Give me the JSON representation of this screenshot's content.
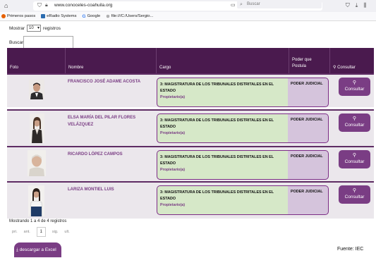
{
  "browser": {
    "url": "www.conoceles-coahuila.org",
    "search_placeholder": "Buscar",
    "bookmarks": [
      {
        "label": "Primeros pasos",
        "icon": "firefox-icon",
        "color": "#e66000"
      },
      {
        "label": "eRadio Systems",
        "icon": "eradio-icon",
        "color": "#2b6cb0"
      },
      {
        "label": "Google",
        "icon": "google-icon",
        "color": "#4285f4"
      },
      {
        "label": "file:///C:/Users/Sergio...",
        "icon": "globe-icon",
        "color": "#666666"
      }
    ]
  },
  "controls": {
    "show_prefix": "Mostrar",
    "show_value": "10",
    "show_suffix": "registros",
    "search_label": "Buscar:"
  },
  "table": {
    "headers": {
      "foto": "Foto",
      "nombre": "Nombre",
      "cargo": "Cargo",
      "poder_line1": "Poder que",
      "poder_line2": "Postula",
      "consultar": "Consultar"
    },
    "rows": [
      {
        "name_line1": "FRANCISCO JOSÉ ADAME ACOSTA",
        "name_line2": "",
        "cargo_line1": "3: MAGISTRATURA DE LOS TRIBUNALES DISTRITALES EN EL",
        "cargo_line2": "ESTADO",
        "tipo": "Propietario(a)",
        "poder": "PODER JUDICIAL",
        "button_label": "Consultar"
      },
      {
        "name_line1": "ELSA MARÍA DEL PILAR FLORES",
        "name_line2": "VELÁZQUEZ",
        "cargo_line1": "3: MAGISTRATURA DE LOS TRIBUNALES DISTRITALES EN EL",
        "cargo_line2": "ESTADO",
        "tipo": "Propietario(a)",
        "poder": "PODER JUDICIAL",
        "button_label": "Consultar"
      },
      {
        "name_line1": "RICARDO LÓPEZ CAMPOS",
        "name_line2": "",
        "cargo_line1": "3: MAGISTRATURA DE LOS TRIBUNALES DISTRITALES EN EL",
        "cargo_line2": "ESTADO",
        "tipo": "Propietario(a)",
        "poder": "PODER JUDICIAL",
        "button_label": "Consultar"
      },
      {
        "name_line1": "LARIZA MONTIEL LUIS",
        "name_line2": "",
        "cargo_line1": "3: MAGISTRATURA DE LOS TRIBUNALES DISTRITALES EN EL",
        "cargo_line2": "ESTADO",
        "tipo": "Propietario(a)",
        "poder": "PODER JUDICIAL",
        "button_label": "Consultar"
      }
    ]
  },
  "footer": {
    "showing": "Mostrando 1 a 4 de 4 registros",
    "pager": {
      "first": "pri.",
      "prev": "ant.",
      "current": "1",
      "next": "sig.",
      "last": "ult."
    },
    "excel_label": "descargar a Excel",
    "source": "Fuente: IEC"
  },
  "colors": {
    "header": "#4a1a4e",
    "accent": "#7a3d84",
    "cargo_bg": "#d6e8c8",
    "poder_bg": "#d5c4dc"
  }
}
